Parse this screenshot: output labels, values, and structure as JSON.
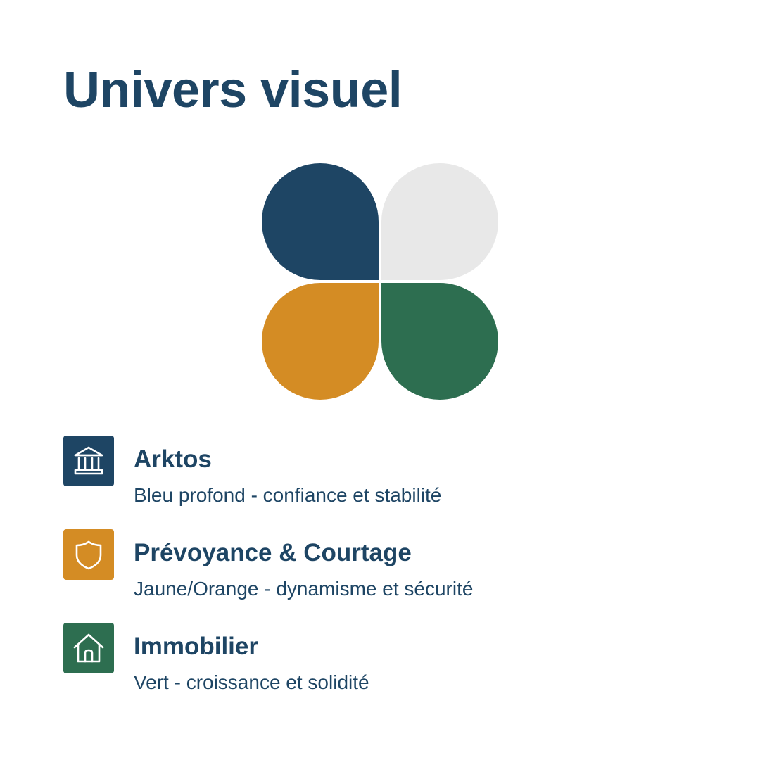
{
  "title": "Univers visuel",
  "colors": {
    "text": "#1e4564",
    "blue": "#1e4564",
    "light_gray": "#e8e8e8",
    "orange": "#d48c24",
    "green": "#2d6e50",
    "background": "#ffffff"
  },
  "logo": {
    "icon": "four-petal-clover-logo",
    "petals": [
      "blue",
      "light_gray",
      "orange",
      "green"
    ]
  },
  "legend": [
    {
      "icon": "bank-building-icon",
      "color": "#1e4564",
      "name": "Arktos",
      "description": "Bleu profond - confiance et stabilité"
    },
    {
      "icon": "shield-icon",
      "color": "#d48c24",
      "name": "Prévoyance & Courtage",
      "description": "Jaune/Orange - dynamisme et sécurité"
    },
    {
      "icon": "house-icon",
      "color": "#2d6e50",
      "name": "Immobilier",
      "description": "Vert - croissance et solidité"
    }
  ]
}
